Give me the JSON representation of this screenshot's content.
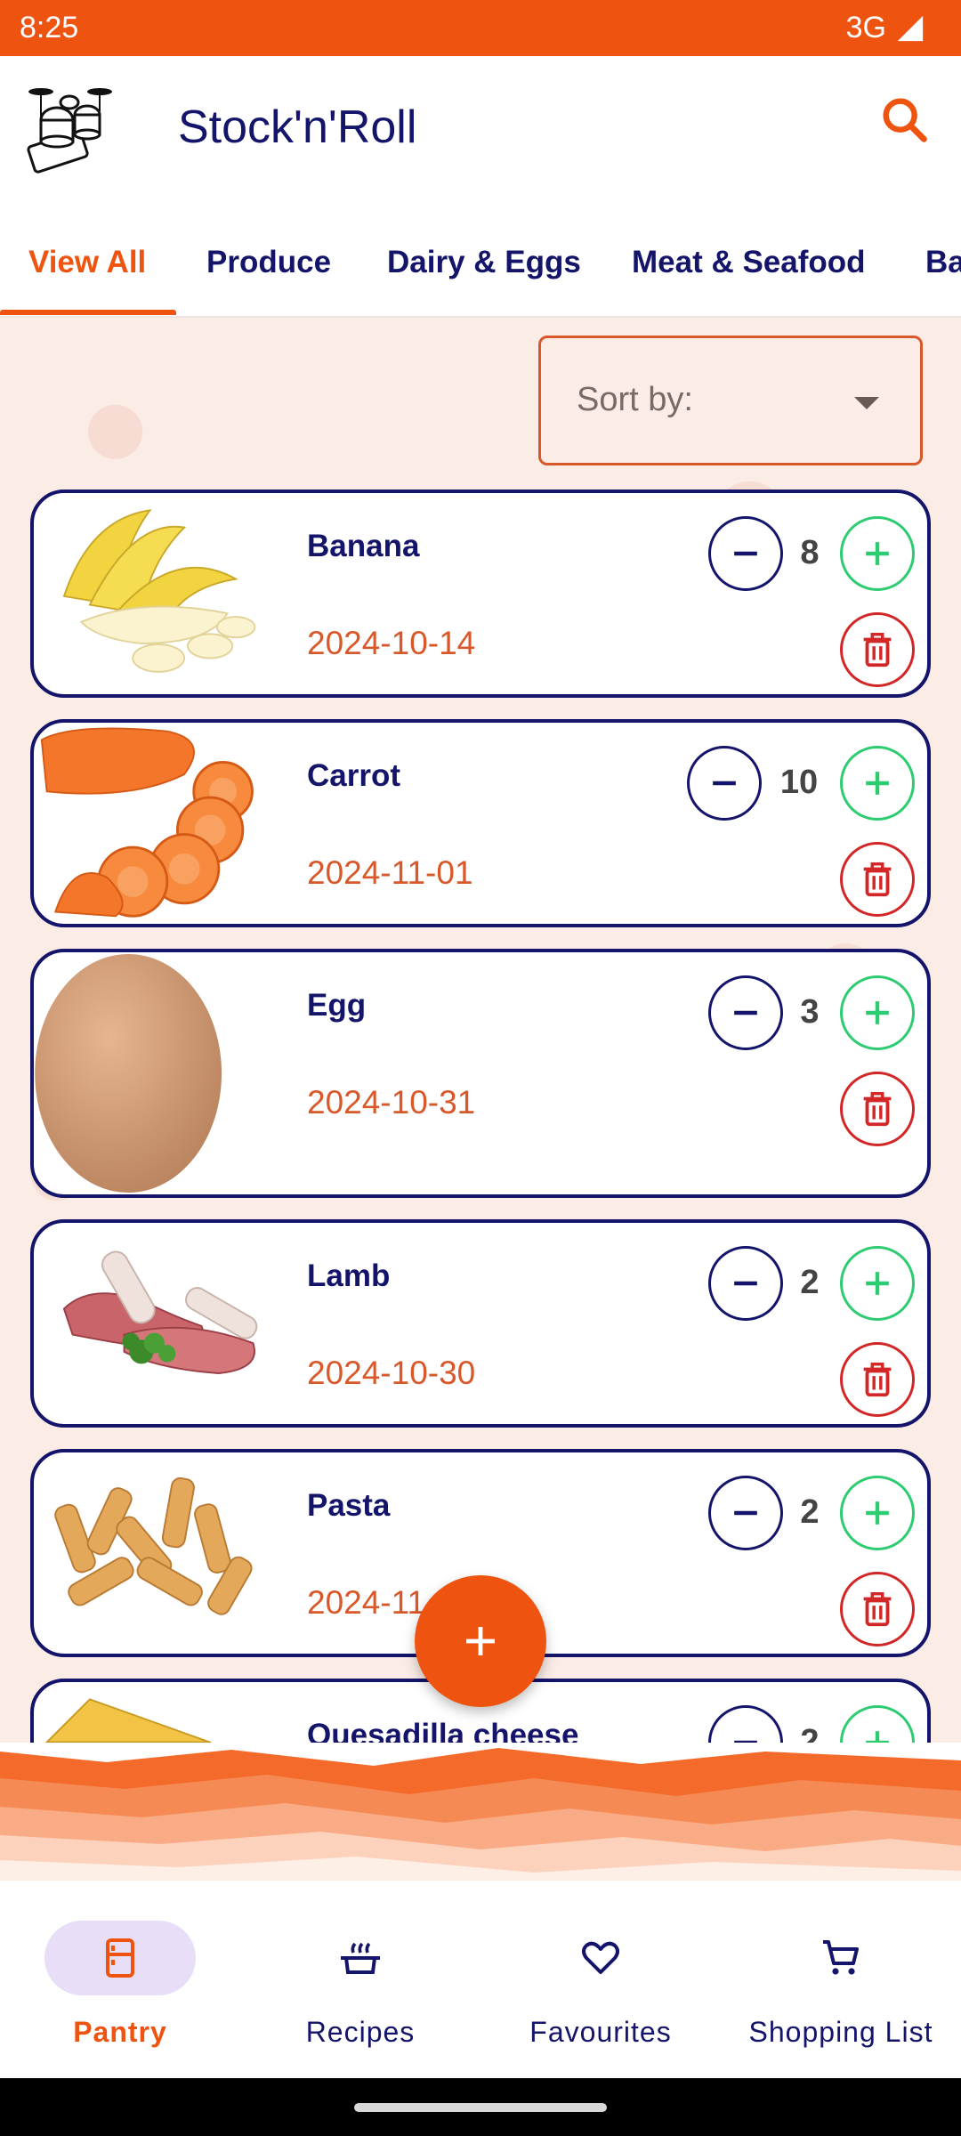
{
  "status_bar": {
    "time": "8:25",
    "network": "3G"
  },
  "app": {
    "title": "Stock'n'Roll",
    "logo_icon": "drum-kit-logo",
    "search_icon": "search-icon"
  },
  "tabs": [
    {
      "label": "View All",
      "active": true
    },
    {
      "label": "Produce"
    },
    {
      "label": "Dairy & Eggs"
    },
    {
      "label": "Meat & Seafood"
    },
    {
      "label": "Ba"
    }
  ],
  "sort": {
    "label": "Sort by:"
  },
  "items": [
    {
      "name": "Banana",
      "date": "2024-10-14",
      "qty": "8",
      "image": "banana"
    },
    {
      "name": "Carrot",
      "date": "2024-11-01",
      "qty": "10",
      "image": "carrot"
    },
    {
      "name": "Egg",
      "date": "2024-10-31",
      "qty": "3",
      "image": "egg"
    },
    {
      "name": "Lamb",
      "date": "2024-10-30",
      "qty": "2",
      "image": "lamb"
    },
    {
      "name": "Pasta",
      "date": "2024-11",
      "qty": "2",
      "image": "pasta"
    },
    {
      "name": "Quesadilla cheese",
      "date": "",
      "qty": "2",
      "image": "cheese"
    }
  ],
  "fab": {
    "icon": "plus-icon"
  },
  "nav": [
    {
      "label": "Pantry",
      "icon": "fridge-icon",
      "active": true
    },
    {
      "label": "Recipes",
      "icon": "cooking-pot-icon"
    },
    {
      "label": "Favourites",
      "icon": "heart-icon"
    },
    {
      "label": "Shopping List",
      "icon": "cart-icon"
    }
  ],
  "colors": {
    "accent": "#ee5310",
    "navy": "#14146b",
    "plus_green": "#2ecc71",
    "delete_red": "#d32626",
    "background": "#fbece6"
  }
}
